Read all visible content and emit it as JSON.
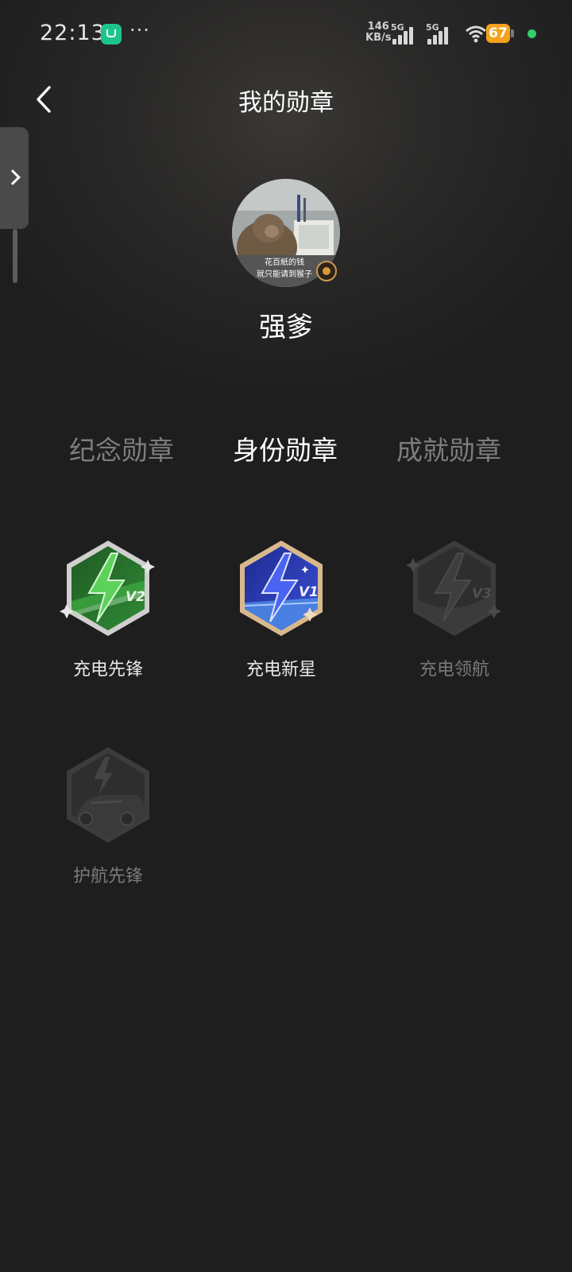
{
  "status_bar": {
    "time": "22:13",
    "net_speed_value": "146",
    "net_speed_unit": "KB/s",
    "sim1": "5G",
    "sim2": "5G",
    "battery": "67",
    "more": "···"
  },
  "header": {
    "title": "我的勋章",
    "back_icon": "chevron-left-icon"
  },
  "profile": {
    "username": "强爹",
    "avatar_caption_line1": "花百紙的钱",
    "avatar_caption_line2": "就只能请到猴子"
  },
  "tabs": [
    {
      "label": "纪念勋章",
      "active": false
    },
    {
      "label": "身份勋章",
      "active": true
    },
    {
      "label": "成就勋章",
      "active": false
    }
  ],
  "badges": [
    {
      "label": "充电先锋",
      "level": "V2",
      "unlocked": true,
      "color": "#2f8a35"
    },
    {
      "label": "充电新星",
      "level": "V1",
      "unlocked": true,
      "color": "#3b4fd6"
    },
    {
      "label": "充电领航",
      "level": "V3",
      "unlocked": false,
      "color": "#3a3a3a"
    },
    {
      "label": "护航先锋",
      "level": "",
      "unlocked": false,
      "color": "#3a3a3a"
    }
  ],
  "colors": {
    "background": "#1e1e1f",
    "active_tab": "#ffffff",
    "inactive_tab": "#7d7d7d",
    "battery": "#f4a21b"
  }
}
